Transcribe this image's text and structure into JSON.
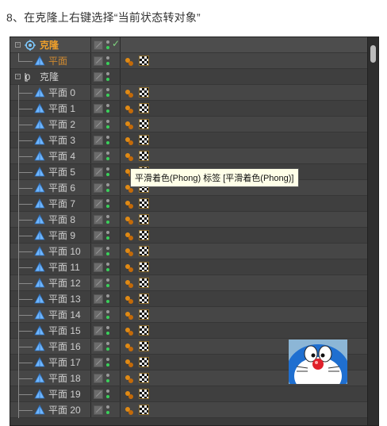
{
  "caption": "8、在克隆上右键选择“当前状态转对象”",
  "tree": {
    "root": {
      "name": "克隆",
      "type": "cloner",
      "selected": true,
      "check": "✓"
    },
    "child": {
      "name": "平面",
      "type": "plane"
    },
    "null_obj": {
      "name": "克隆",
      "type": "null"
    },
    "planes": [
      "平面 0",
      "平面 1",
      "平面 2",
      "平面 3",
      "平面 4",
      "平面 5",
      "平面 6",
      "平面 7",
      "平面 8",
      "平面 9",
      "平面 10",
      "平面 11",
      "平面 12",
      "平面 13",
      "平面 14",
      "平面 15",
      "平面 16",
      "平面 17",
      "平面 18",
      "平面 19",
      "平面 20"
    ]
  },
  "tooltip": "平滑着色(Phong) 标签 [平滑着色(Phong)]",
  "colors": {
    "accent": "#f0a02a",
    "panel": "#3b3b3b",
    "dot_green": "#39d15a",
    "dot_gray": "#9a9a9a",
    "tag_orange": "#d07a10"
  },
  "icons": {
    "cloner": "cloner-icon",
    "plane": "plane-icon",
    "null": "null-icon",
    "phong": "phong-tag-icon",
    "material": "material-tag-icon"
  }
}
